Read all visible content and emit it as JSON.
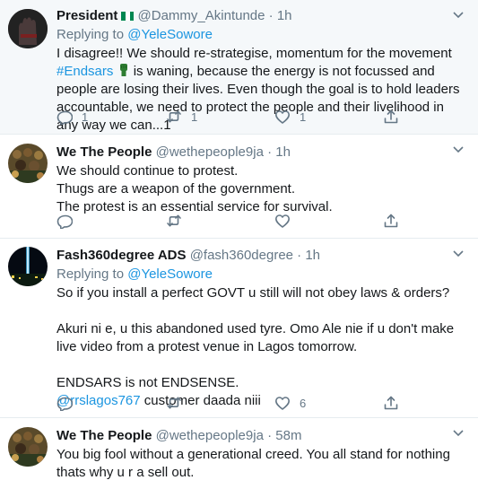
{
  "tweets": [
    {
      "name": "President",
      "handle": "@Dammy_Akintunde",
      "time": "1h",
      "replying_prefix": "Replying to",
      "replying_to": "@YeleSowore",
      "text_a": "I disagree!! We should re-strategise, momentum for the movement ",
      "hashtag": "#Endsars",
      "text_b": " is waning, because the energy is not focussed and people are losing their lives. Even though the goal is to hold leaders accountable, we need to protect the people and their livelihood in any way we can...1",
      "counts": {
        "reply": "1",
        "retweet": "1",
        "like": "1"
      },
      "flag_colors": [
        "#008751",
        "#ffffff",
        "#008751"
      ]
    },
    {
      "name": "We The People",
      "handle": "@wethepeople9ja",
      "time": "1h",
      "lines": [
        "We should continue to protest.",
        "Thugs are a weapon of the government.",
        "The protest is an essential service for survival."
      ]
    },
    {
      "name": "Fash360degree ADS",
      "handle": "@fash360degree",
      "time": "1h",
      "replying_prefix": "Replying to",
      "replying_to": "@YeleSowore",
      "line1": "So if you install a perfect GOVT u still will not obey laws & orders?",
      "line2": "Akuri ni e, u this abandoned used tyre. Omo Ale nie if u don't make live video from a protest venue in Lagos tomorrow.",
      "line3": "ENDSARS is not ENDSENSE.",
      "mention": "@rrslagos767",
      "line4": " customer daada niii",
      "counts": {
        "like": "6"
      }
    },
    {
      "name": "We The People",
      "handle": "@wethepeople9ja",
      "time": "58m",
      "text": "You big fool without a generational creed. You all stand for nothing thats why u r a sell out."
    }
  ],
  "separator": "·",
  "icons": [
    "reply-icon",
    "retweet-icon",
    "like-icon",
    "share-icon",
    "chevron-down-icon"
  ],
  "colors": {
    "link": "#1b95e0",
    "secondary": "#657786",
    "highlight_bg": "#f5f8fa",
    "border": "#e6ecf0"
  }
}
